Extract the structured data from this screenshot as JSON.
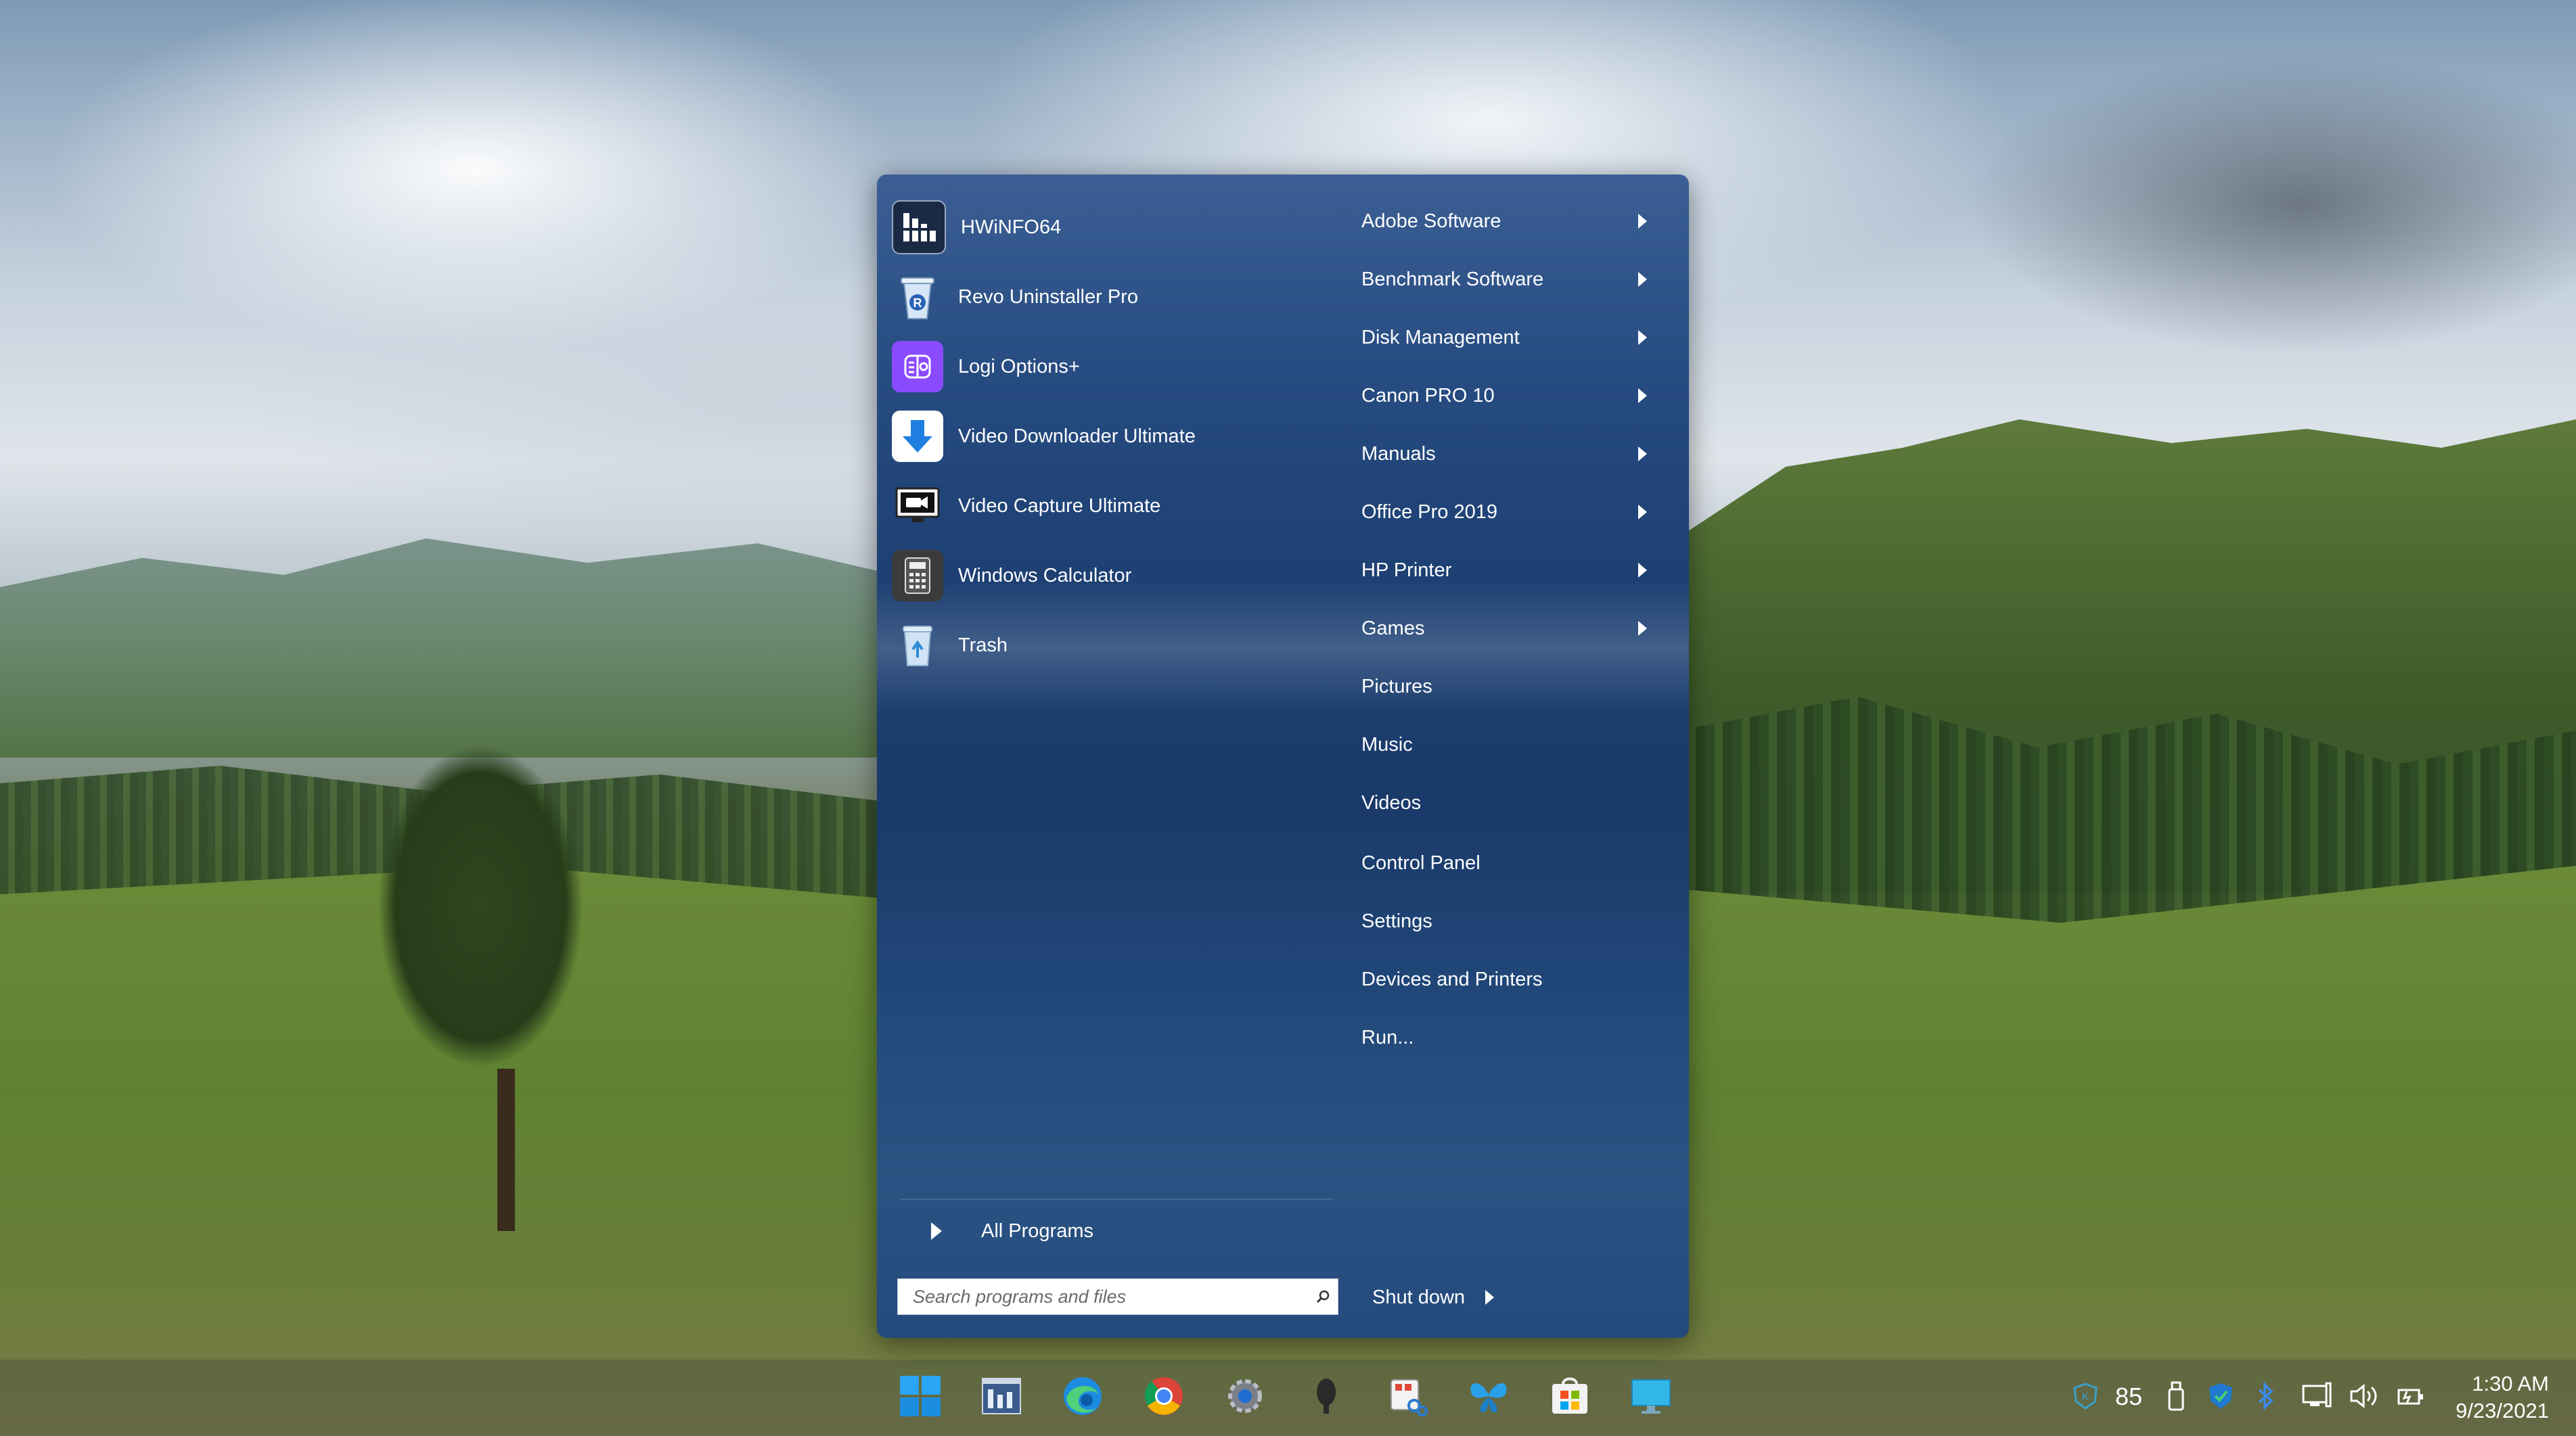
{
  "start_menu": {
    "pinned_programs": [
      {
        "label": "HWiNFO64",
        "icon": "hwinfo-icon"
      },
      {
        "label": "Revo Uninstaller Pro",
        "icon": "revo-uninstaller-icon"
      },
      {
        "label": "Logi Options+",
        "icon": "logi-options-icon"
      },
      {
        "label": "Video Downloader Ultimate",
        "icon": "download-arrow-icon"
      },
      {
        "label": "Video Capture Ultimate",
        "icon": "video-camera-icon"
      },
      {
        "label": "Windows Calculator",
        "icon": "calculator-icon"
      },
      {
        "label": "Trash",
        "icon": "recycle-bin-icon"
      }
    ],
    "all_programs_label": "All Programs",
    "search_placeholder": "Search programs and files",
    "right_links": [
      {
        "label": "Adobe Software",
        "submenu": true
      },
      {
        "label": "Benchmark Software",
        "submenu": true
      },
      {
        "label": "Disk Management",
        "submenu": true
      },
      {
        "label": "Canon PRO 10",
        "submenu": true
      },
      {
        "label": "Manuals",
        "submenu": true
      },
      {
        "label": "Office Pro 2019",
        "submenu": true
      },
      {
        "label": "HP Printer",
        "submenu": true
      },
      {
        "label": "Games",
        "submenu": true
      },
      {
        "label": "Pictures",
        "submenu": false
      },
      {
        "label": "Music",
        "submenu": false
      },
      {
        "label": "Videos",
        "submenu": false
      },
      {
        "label": "Control Panel",
        "submenu": false
      },
      {
        "label": "Settings",
        "submenu": false
      },
      {
        "label": "Devices and Printers",
        "submenu": false
      },
      {
        "label": "Run...",
        "submenu": false
      }
    ],
    "shutdown_label": "Shut down"
  },
  "taskbar": {
    "apps": [
      "windows-start-icon",
      "task-manager-icon",
      "edge-icon",
      "chrome-icon",
      "settings-gear-icon",
      "microphone-icon",
      "snipping-tool-icon",
      "butterfly-app-icon",
      "microsoft-store-icon",
      "desktop-monitor-icon"
    ]
  },
  "tray": {
    "temperature": "85",
    "time": "1:30 AM",
    "date": "9/23/2021"
  }
}
